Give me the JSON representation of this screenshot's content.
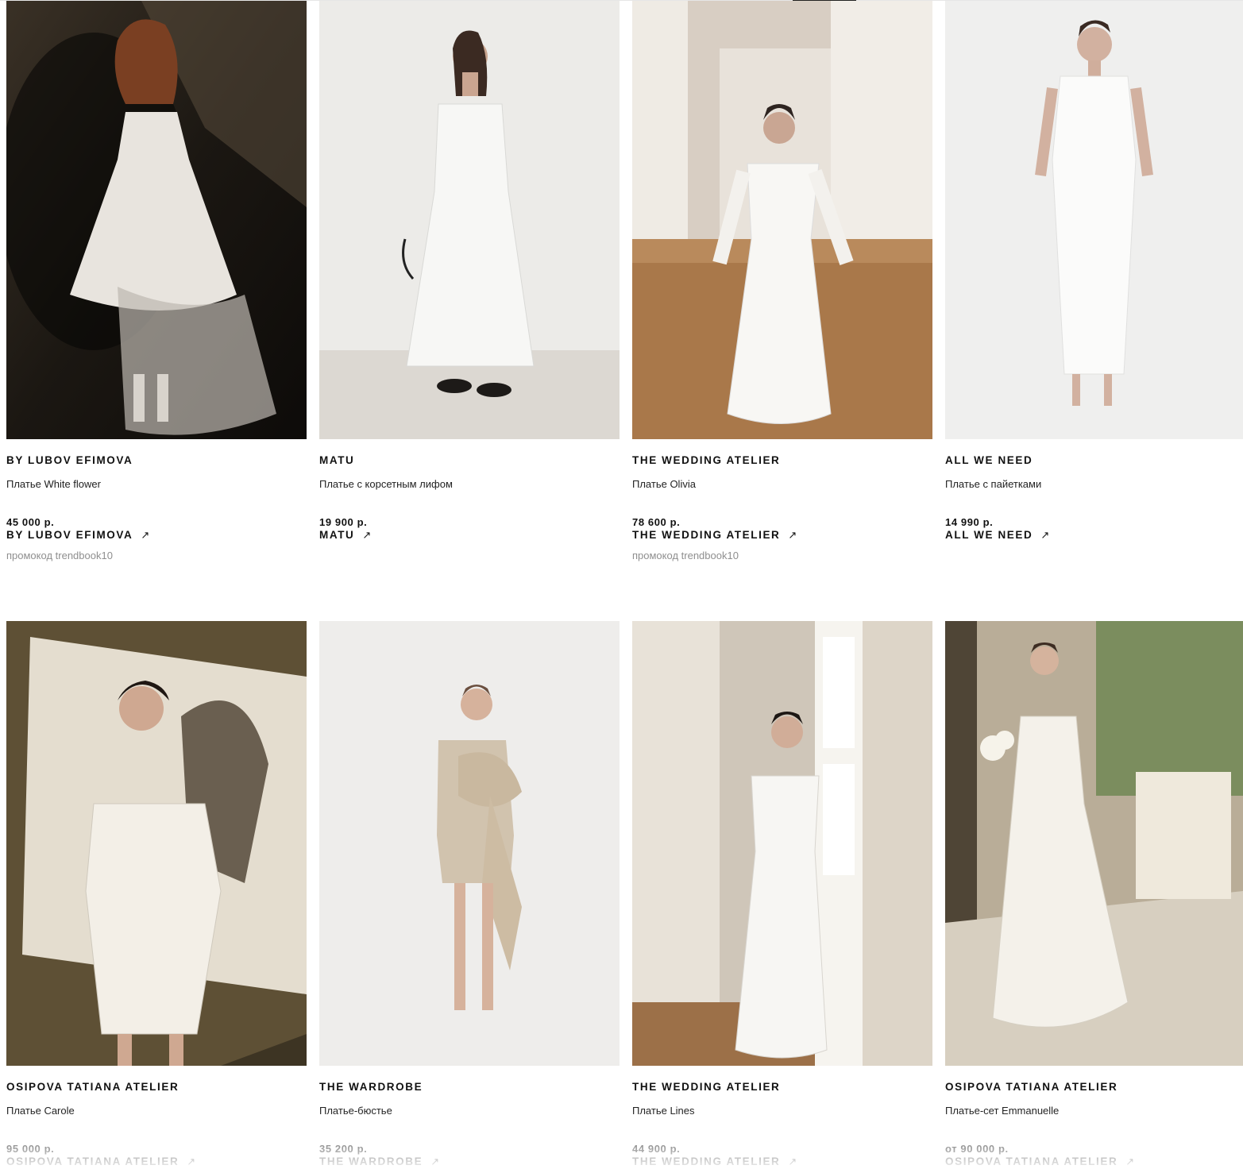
{
  "products": [
    {
      "brand": "BY LUBOV EFIMOVA",
      "name": "Платье White flower",
      "price": "45 000 р.",
      "shop": "BY LUBOV EFIMOVA",
      "promo": "промокод trendbook10",
      "image": "dress-photo-white-flower"
    },
    {
      "brand": "MATU",
      "name": "Платье с корсетным лифом",
      "price": "19 900 р.",
      "shop": "MATU",
      "promo": "",
      "image": "dress-photo-corset"
    },
    {
      "brand": "THE WEDDING ATELIER",
      "name": "Платье Olivia",
      "price": "78 600 р.",
      "shop": "THE WEDDING ATELIER",
      "promo": "промокод trendbook10",
      "image": "dress-photo-olivia"
    },
    {
      "brand": "ALL WE NEED",
      "name": "Платье с пайетками",
      "price": "14 990 р.",
      "shop": "ALL WE NEED",
      "promo": "",
      "image": "dress-photo-sequins"
    },
    {
      "brand": "OSIPOVA TATIANA ATELIER",
      "name": "Платье Carole",
      "price": "95 000 р.",
      "shop": "OSIPOVA TATIANA ATELIER",
      "promo": "",
      "image": "dress-photo-carole"
    },
    {
      "brand": "THE WARDROBE",
      "name": "Платье-бюстье",
      "price": "35 200 р.",
      "shop": "THE WARDROBE",
      "promo": "",
      "image": "dress-photo-bustier"
    },
    {
      "brand": "THE WEDDING ATELIER",
      "name": "Платье Lines",
      "price": "44 900 р.",
      "shop": "THE WEDDING ATELIER",
      "promo": "",
      "image": "dress-photo-lines"
    },
    {
      "brand": "OSIPOVA TATIANA ATELIER",
      "name": "Платье-сет Emmanuelle",
      "price": "от 90 000 р.",
      "shop": "OSIPOVA TATIANA ATELIER",
      "promo": "",
      "image": "dress-photo-emmanuelle"
    }
  ],
  "icons": {
    "external_link": "arrow-up-right-icon",
    "arrow_glyph": "↗"
  },
  "colors": {
    "text": "#111111",
    "promo": "#8f8f8f",
    "background": "#ffffff"
  }
}
